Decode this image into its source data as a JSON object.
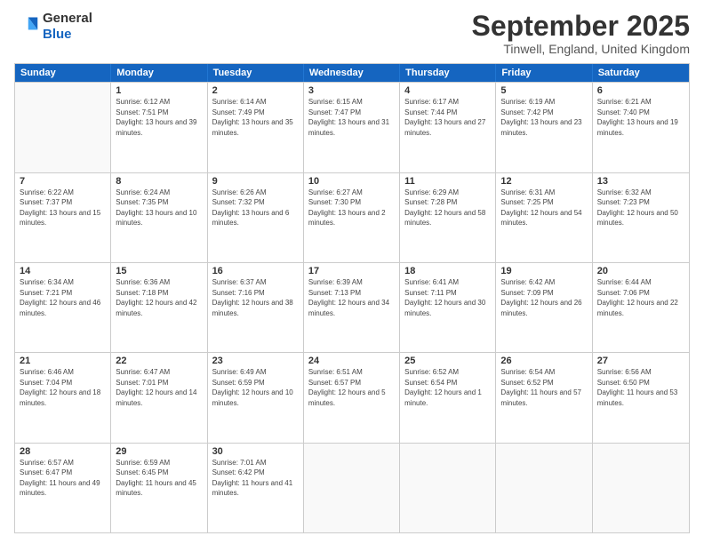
{
  "header": {
    "logo_line1": "General",
    "logo_line2": "Blue",
    "month_title": "September 2025",
    "location": "Tinwell, England, United Kingdom"
  },
  "days_of_week": [
    "Sunday",
    "Monday",
    "Tuesday",
    "Wednesday",
    "Thursday",
    "Friday",
    "Saturday"
  ],
  "weeks": [
    [
      {
        "day": "",
        "empty": true
      },
      {
        "day": "1",
        "sunrise": "6:12 AM",
        "sunset": "7:51 PM",
        "daylight": "13 hours and 39 minutes."
      },
      {
        "day": "2",
        "sunrise": "6:14 AM",
        "sunset": "7:49 PM",
        "daylight": "13 hours and 35 minutes."
      },
      {
        "day": "3",
        "sunrise": "6:15 AM",
        "sunset": "7:47 PM",
        "daylight": "13 hours and 31 minutes."
      },
      {
        "day": "4",
        "sunrise": "6:17 AM",
        "sunset": "7:44 PM",
        "daylight": "13 hours and 27 minutes."
      },
      {
        "day": "5",
        "sunrise": "6:19 AM",
        "sunset": "7:42 PM",
        "daylight": "13 hours and 23 minutes."
      },
      {
        "day": "6",
        "sunrise": "6:21 AM",
        "sunset": "7:40 PM",
        "daylight": "13 hours and 19 minutes."
      }
    ],
    [
      {
        "day": "7",
        "sunrise": "6:22 AM",
        "sunset": "7:37 PM",
        "daylight": "13 hours and 15 minutes."
      },
      {
        "day": "8",
        "sunrise": "6:24 AM",
        "sunset": "7:35 PM",
        "daylight": "13 hours and 10 minutes."
      },
      {
        "day": "9",
        "sunrise": "6:26 AM",
        "sunset": "7:32 PM",
        "daylight": "13 hours and 6 minutes."
      },
      {
        "day": "10",
        "sunrise": "6:27 AM",
        "sunset": "7:30 PM",
        "daylight": "13 hours and 2 minutes."
      },
      {
        "day": "11",
        "sunrise": "6:29 AM",
        "sunset": "7:28 PM",
        "daylight": "12 hours and 58 minutes."
      },
      {
        "day": "12",
        "sunrise": "6:31 AM",
        "sunset": "7:25 PM",
        "daylight": "12 hours and 54 minutes."
      },
      {
        "day": "13",
        "sunrise": "6:32 AM",
        "sunset": "7:23 PM",
        "daylight": "12 hours and 50 minutes."
      }
    ],
    [
      {
        "day": "14",
        "sunrise": "6:34 AM",
        "sunset": "7:21 PM",
        "daylight": "12 hours and 46 minutes."
      },
      {
        "day": "15",
        "sunrise": "6:36 AM",
        "sunset": "7:18 PM",
        "daylight": "12 hours and 42 minutes."
      },
      {
        "day": "16",
        "sunrise": "6:37 AM",
        "sunset": "7:16 PM",
        "daylight": "12 hours and 38 minutes."
      },
      {
        "day": "17",
        "sunrise": "6:39 AM",
        "sunset": "7:13 PM",
        "daylight": "12 hours and 34 minutes."
      },
      {
        "day": "18",
        "sunrise": "6:41 AM",
        "sunset": "7:11 PM",
        "daylight": "12 hours and 30 minutes."
      },
      {
        "day": "19",
        "sunrise": "6:42 AM",
        "sunset": "7:09 PM",
        "daylight": "12 hours and 26 minutes."
      },
      {
        "day": "20",
        "sunrise": "6:44 AM",
        "sunset": "7:06 PM",
        "daylight": "12 hours and 22 minutes."
      }
    ],
    [
      {
        "day": "21",
        "sunrise": "6:46 AM",
        "sunset": "7:04 PM",
        "daylight": "12 hours and 18 minutes."
      },
      {
        "day": "22",
        "sunrise": "6:47 AM",
        "sunset": "7:01 PM",
        "daylight": "12 hours and 14 minutes."
      },
      {
        "day": "23",
        "sunrise": "6:49 AM",
        "sunset": "6:59 PM",
        "daylight": "12 hours and 10 minutes."
      },
      {
        "day": "24",
        "sunrise": "6:51 AM",
        "sunset": "6:57 PM",
        "daylight": "12 hours and 5 minutes."
      },
      {
        "day": "25",
        "sunrise": "6:52 AM",
        "sunset": "6:54 PM",
        "daylight": "12 hours and 1 minute."
      },
      {
        "day": "26",
        "sunrise": "6:54 AM",
        "sunset": "6:52 PM",
        "daylight": "11 hours and 57 minutes."
      },
      {
        "day": "27",
        "sunrise": "6:56 AM",
        "sunset": "6:50 PM",
        "daylight": "11 hours and 53 minutes."
      }
    ],
    [
      {
        "day": "28",
        "sunrise": "6:57 AM",
        "sunset": "6:47 PM",
        "daylight": "11 hours and 49 minutes."
      },
      {
        "day": "29",
        "sunrise": "6:59 AM",
        "sunset": "6:45 PM",
        "daylight": "11 hours and 45 minutes."
      },
      {
        "day": "30",
        "sunrise": "7:01 AM",
        "sunset": "6:42 PM",
        "daylight": "11 hours and 41 minutes."
      },
      {
        "day": "",
        "empty": true
      },
      {
        "day": "",
        "empty": true
      },
      {
        "day": "",
        "empty": true
      },
      {
        "day": "",
        "empty": true
      }
    ]
  ]
}
